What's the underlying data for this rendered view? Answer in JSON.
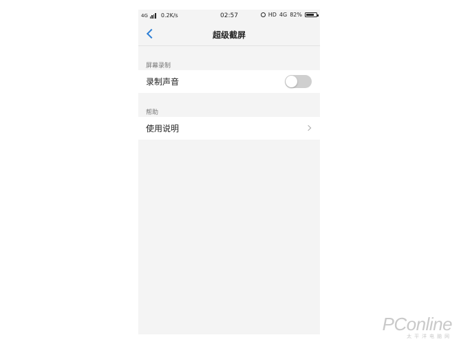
{
  "status_bar": {
    "network": "4G",
    "speed": "0.2K/s",
    "time": "02:57",
    "hd": "HD",
    "wifi": "4G",
    "battery_text": "82%",
    "battery_level": 0.82
  },
  "header": {
    "back_icon": "chevron-left-icon",
    "title": "超级截屏"
  },
  "sections": [
    {
      "label": "屏幕录制",
      "items": [
        {
          "label": "录制声音",
          "control": "toggle",
          "toggle_on": false
        }
      ]
    },
    {
      "label": "帮助",
      "items": [
        {
          "label": "使用说明",
          "control": "chevron-right-icon"
        }
      ]
    }
  ],
  "watermark": {
    "logo": "PConline",
    "sub": "太平洋电脑网"
  },
  "colors": {
    "accent": "#2d7fd6",
    "background": "#f4f4f4",
    "row": "#ffffff",
    "toggle_off": "#cfcfcf"
  }
}
